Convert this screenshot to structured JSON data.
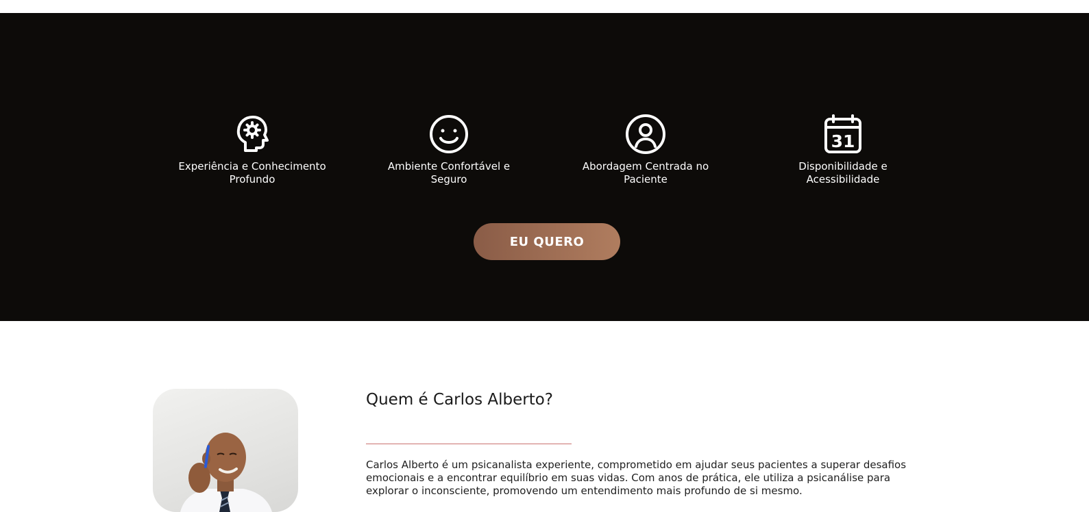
{
  "features": [
    {
      "icon": "head-gear-icon",
      "label": "Experiência e Conhecimento Profundo"
    },
    {
      "icon": "smiley-icon",
      "label": "Ambiente Confortável e Seguro"
    },
    {
      "icon": "user-circle-icon",
      "label": "Abordagem Centrada no Paciente"
    },
    {
      "icon": "calendar-icon",
      "label": "Disponibilidade e Acessibilidade",
      "calendar_day": "31"
    }
  ],
  "cta": {
    "label": "EU QUERO"
  },
  "about": {
    "title": "Quem é Carlos Alberto?",
    "text": "Carlos Alberto é um psicanalista experiente, comprometido em ajudar seus pacientes a superar desafios emocionais e a encontrar equilíbrio em suas vidas. Com anos de prática, ele utiliza a psicanálise para explorar o inconsciente, promovendo um entendimento mais profundo de si mesmo."
  },
  "colors": {
    "dark_band": "#0d0b09",
    "cta_gradient_start": "#8a5c47",
    "cta_gradient_end": "#b07d5f",
    "divider": "#c9716f"
  }
}
